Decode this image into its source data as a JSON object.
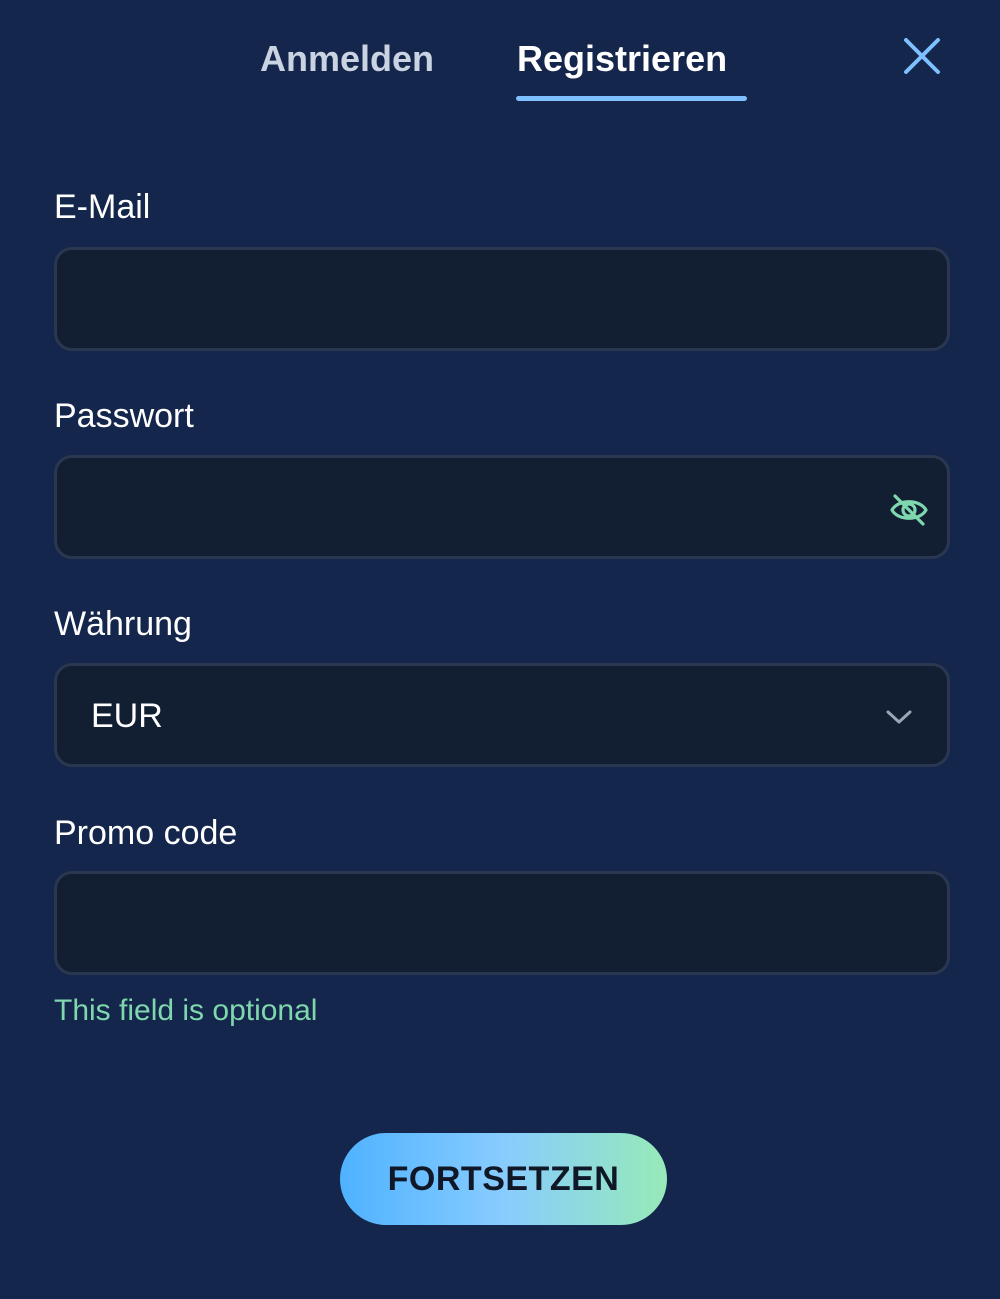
{
  "tabs": {
    "login_label": "Anmelden",
    "register_label": "Registrieren",
    "active": "register"
  },
  "icons": {
    "close": "close-icon",
    "password_toggle": "eye-slash-icon",
    "dropdown": "chevron-down-icon"
  },
  "form": {
    "email": {
      "label": "E-Mail",
      "value": "",
      "placeholder": ""
    },
    "password": {
      "label": "Passwort",
      "value": "",
      "placeholder": ""
    },
    "currency": {
      "label": "Währung",
      "selected": "EUR"
    },
    "promo": {
      "label": "Promo code",
      "value": "",
      "placeholder": "",
      "hint": "This field is optional"
    }
  },
  "submit": {
    "label": "FORTSETZEN"
  },
  "colors": {
    "background": "#14264b",
    "field_background": "#121e32",
    "accent_blue": "#7ec0ff",
    "accent_green": "#7fd7ae"
  }
}
